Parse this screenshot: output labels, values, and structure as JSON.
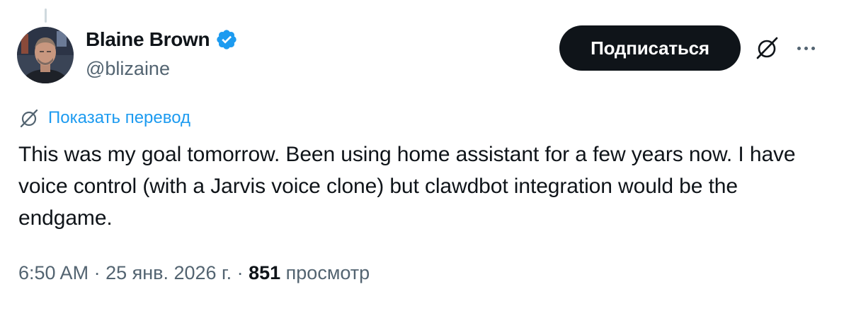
{
  "author": {
    "display_name": "Blaine Brown",
    "handle": "@blizaine",
    "verified": true
  },
  "actions": {
    "subscribe_label": "Подписаться",
    "grok_icon": "grok-icon",
    "more_icon": "more-icon"
  },
  "translate": {
    "label": "Показать перевод",
    "icon": "grok-icon"
  },
  "tweet": {
    "text": "This was my goal tomorrow. Been using home assistant for a few years now. I have voice control (with a Jarvis voice clone) but clawdbot integration would be the endgame."
  },
  "meta": {
    "time": "6:50 AM",
    "separator": " · ",
    "date": "25 янв. 2026 г.",
    "views_count": "851",
    "views_label": "просмотр"
  },
  "colors": {
    "text": "#0f1419",
    "secondary": "#536471",
    "link": "#1d9bf0",
    "button_bg": "#0f1419",
    "verified": "#1d9bf0"
  }
}
